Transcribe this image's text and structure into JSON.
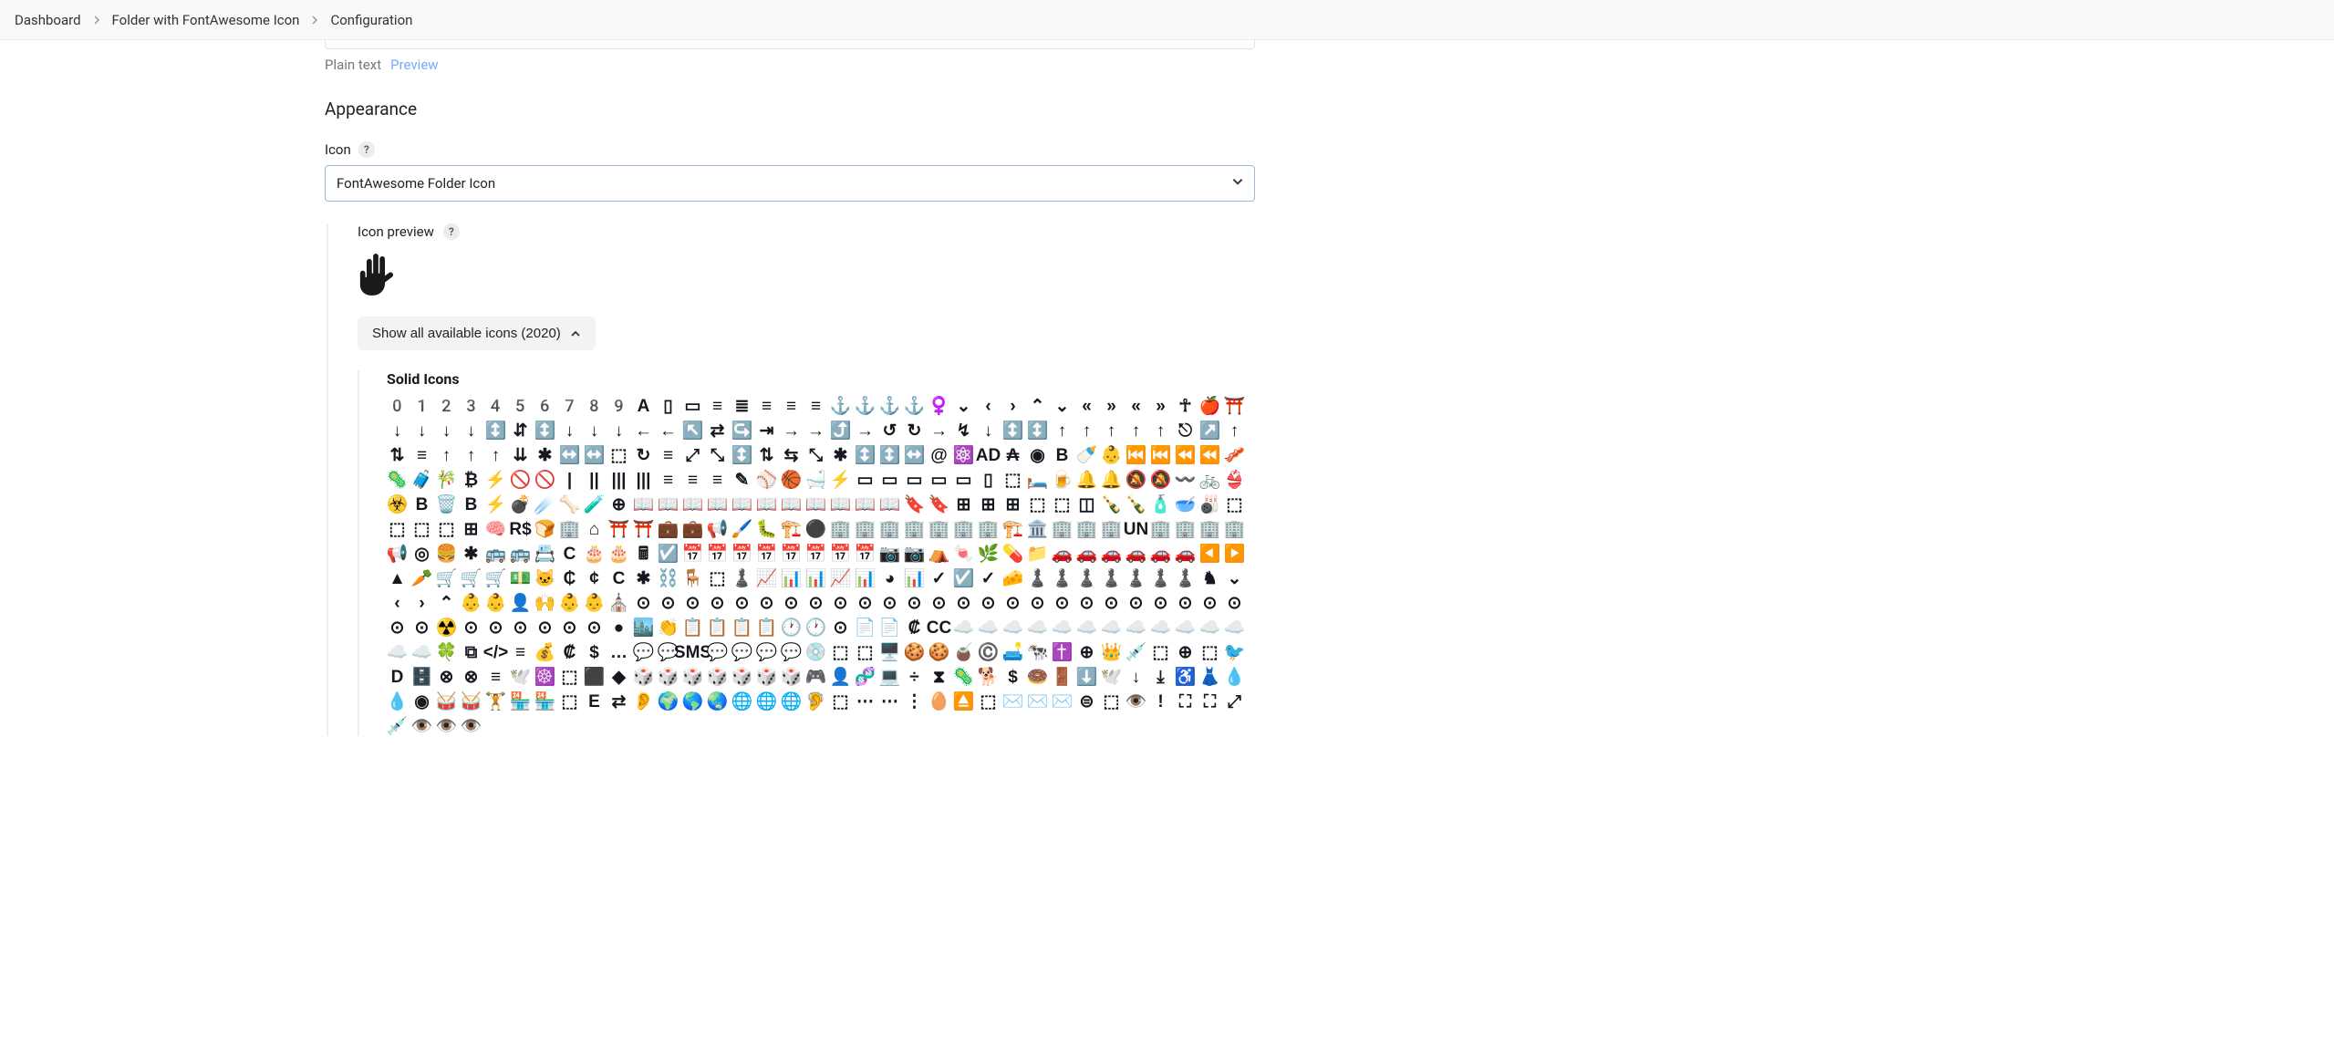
{
  "breadcrumb": {
    "items": [
      "Dashboard",
      "Folder with FontAwesome Icon",
      "Configuration"
    ]
  },
  "tabs": {
    "plain": "Plain text",
    "preview": "Preview"
  },
  "section": {
    "title": "Appearance"
  },
  "icon_field": {
    "label": "Icon",
    "help": "?",
    "value": "FontAwesome Folder Icon"
  },
  "preview": {
    "label": "Icon preview",
    "help": "?",
    "icon_name": "hand-peace"
  },
  "expand": {
    "label": "Show all available icons (2020)"
  },
  "icon_category": {
    "title": "Solid Icons"
  },
  "glyphs": {
    "row1": [
      "0",
      "1",
      "2",
      "3",
      "4",
      "5",
      "6",
      "7",
      "8",
      "9",
      "A",
      "▯",
      "▭",
      "≡",
      "≣",
      "≡",
      "≡",
      "≡",
      "⚓",
      "⚓",
      "⚓",
      "⚓",
      "♀",
      "⌄",
      "‹",
      "›",
      "⌃",
      "⌄",
      "«",
      "»",
      "«",
      "»",
      "☥",
      "🍎",
      "⛩",
      "↓",
      "↓"
    ],
    "row2": [
      "↓",
      "↓",
      "↕",
      "⇵",
      "↕",
      "↓",
      "↓",
      "↓",
      "←",
      "←",
      "↖",
      "⇄",
      "↪",
      "⇥",
      "→",
      "→",
      "⤴",
      "→",
      "↺",
      "↻",
      "→",
      "↯",
      "↓",
      "↕",
      "↕",
      "↑",
      "↑",
      "↑",
      "↑",
      "↑",
      "⎋",
      "↗",
      "↑",
      "⇅",
      "≡",
      "↑",
      "↑"
    ],
    "row3": [
      "↑",
      "⇊",
      "✱",
      "↔",
      "↔",
      "⬚",
      "↻",
      "≡",
      "⤢",
      "⤡",
      "↕",
      "⇅",
      "⇆",
      "⤡",
      "✱",
      "↕",
      "↕",
      "↔",
      "@",
      "⚛",
      "AD",
      "₳",
      "◉",
      "B",
      "🍼",
      "👶",
      "⏮",
      "⏮",
      "⏪",
      "⏪",
      "🥓",
      "🦠",
      "🧳",
      "🎋",
      "₿",
      "⚡",
      "🚫"
    ],
    "row4": [
      "🚫",
      "|",
      "||",
      "|||",
      "|||",
      "≡",
      "≡",
      "≡",
      "✎",
      "⚾",
      "🏀",
      "🛁",
      "⚡",
      "▭",
      "▭",
      "▭",
      "▭",
      "▭",
      "▯",
      "⬚",
      "🛏",
      "🍺",
      "🔔",
      "🔔",
      "🔕",
      "🔕",
      "〰",
      "🚲",
      "👙",
      "☣",
      "B",
      "🗑",
      "B",
      "⚡",
      "💣",
      "☄"
    ],
    "row5": [
      "🦴",
      "🧪",
      "⊕",
      "📖",
      "📖",
      "📖",
      "📖",
      "📖",
      "📖",
      "📖",
      "📖",
      "📖",
      "📖",
      "📖",
      "🔖",
      "🔖",
      "⊞",
      "⊞",
      "⊞",
      "⬚",
      "⬚",
      "◫",
      "🍾",
      "🍾",
      "🧴",
      "🥣",
      "🎳",
      "⬚",
      "⬚",
      "⬚",
      "⬚",
      "⊞",
      "🧠",
      "R$",
      "🍞",
      "🏢"
    ],
    "row6": [
      "⌂",
      "⛩",
      "⛩",
      "💼",
      "💼",
      "📢",
      "🖌",
      "🐛",
      "🏗",
      "⚫",
      "🏢",
      "🏢",
      "🏢",
      "🏢",
      "🏢",
      "🏢",
      "🏢",
      "🏗",
      "🏛",
      "🏢",
      "🏢",
      "🏢",
      "UN",
      "🏢",
      "🏢",
      "🏢",
      "🏢",
      "📢",
      "◎",
      "🍔",
      "✱",
      "🚌",
      "🚌",
      "📇",
      "C",
      "🎂"
    ],
    "row7": [
      "🎂",
      "🖩",
      "☑",
      "📅",
      "📅",
      "📅",
      "📅",
      "📅",
      "📅",
      "📅",
      "📅",
      "📷",
      "📷",
      "⛺",
      "🍬",
      "🌿",
      "💊",
      "📁",
      "🚗",
      "🚗",
      "🚗",
      "🚗",
      "🚗",
      "🚗",
      "◀",
      "▶",
      "▲",
      "🥕",
      "🛒",
      "🛒",
      "🛒",
      "💵",
      "🐱"
    ],
    "row8": [
      "₵",
      "¢",
      "C",
      "✱",
      "⛓",
      "🪑",
      "⬚",
      "♟",
      "📈",
      "📊",
      "📊",
      "📈",
      "📊",
      "◕",
      "📊",
      "✓",
      "☑",
      "✓",
      "🧀",
      "♟",
      "♟",
      "♟",
      "♟",
      "♟",
      "♟",
      "♟",
      "♞",
      "⌄",
      "‹",
      "›",
      "⌃",
      "👶",
      "👶",
      "👤"
    ],
    "row9": [
      "🙌",
      "👶",
      "👶",
      "⛪",
      "⊙",
      "⊙",
      "⊙",
      "⊙",
      "⊙",
      "⊙",
      "⊙",
      "⊙",
      "⊙",
      "⊙",
      "⊙",
      "⊙",
      "⊙",
      "⊙",
      "⊙",
      "⊙",
      "⊙",
      "⊙",
      "⊙",
      "⊙",
      "⊙",
      "⊙",
      "⊙",
      "⊙",
      "⊙",
      "⊙",
      "⊙",
      "☢",
      "⊙",
      "⊙",
      "⊙",
      "⊙",
      "⊙",
      "⊙",
      "●"
    ],
    "row10": [
      "🏙",
      "👏",
      "📋",
      "📋",
      "📋",
      "📋",
      "🕐",
      "🕐",
      "⊙",
      "📄",
      "📄",
      "₡",
      "CC",
      "☁",
      "☁",
      "☁",
      "☁",
      "☁",
      "☁",
      "☁",
      "☁",
      "☁",
      "☁",
      "☁",
      "☁",
      "☁",
      "☁",
      "🍀",
      "⧉",
      "</>",
      "≡",
      "💰",
      "₡",
      "$",
      "…"
    ],
    "row11": [
      "💬",
      "💬",
      "SMS",
      "💬",
      "💬",
      "💬",
      "💬",
      "💿",
      "⬚",
      "⬚",
      "🖥",
      "🍪",
      "🍪",
      "🧉",
      "©",
      "🛋",
      "🐄",
      "✝",
      "⊕",
      "👑",
      "💉",
      "⬚",
      "⊕",
      "⬚",
      "🐦",
      "D",
      "🗄",
      "⊗",
      "⊗",
      "≡",
      "🕊"
    ],
    "row12": [
      "☸",
      "⬚",
      "⬛",
      "◆",
      "🎲",
      "🎲",
      "🎲",
      "🎲",
      "🎲",
      "🎲",
      "🎲",
      "🎮",
      "👤",
      "🧬",
      "💻",
      "÷",
      "⧗",
      "🦠",
      "🐕",
      "$",
      "🍩",
      "🚪",
      "⬇",
      "🕊",
      "↓",
      "⤓",
      "♿",
      "👗",
      "💧",
      "💧",
      "◉"
    ],
    "row13": [
      "🥁",
      "🥁",
      "🏋",
      "🏪",
      "🏪",
      "⬚",
      "E",
      "⇄",
      "👂",
      "🌍",
      "🌎",
      "🌏",
      "🌐",
      "🌐",
      "🌐",
      "🦻",
      "⬚",
      "⋯",
      "⋯",
      "⋮",
      "🥚",
      "⏏",
      "⬚",
      "✉",
      "✉",
      "✉",
      "⊜",
      "⬚",
      "👁",
      "!",
      "⛶",
      "⛶",
      "⤢",
      "💉",
      "👁",
      "👁",
      "👁"
    ]
  }
}
